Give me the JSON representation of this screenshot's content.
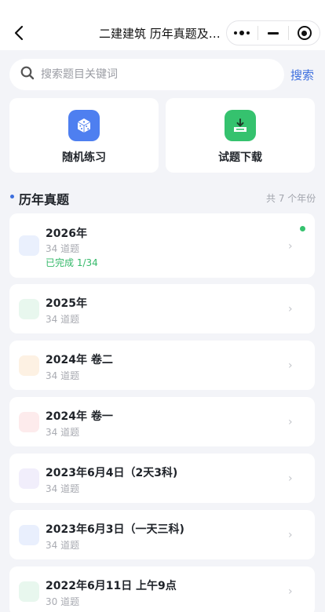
{
  "nav": {
    "title": "二建建筑 历年真题及解析"
  },
  "search": {
    "placeholder": "搜索题目关键词",
    "button_label": "搜索"
  },
  "quick": {
    "practice_label": "随机练习",
    "download_label": "试题下载"
  },
  "section": {
    "title": "历年真题",
    "count": "共 7 个年份"
  },
  "years": [
    {
      "title": "2026年",
      "sub": "34 道题",
      "progress": "已完成 1/34",
      "badge_color": "#eaf0fd"
    },
    {
      "title": "2025年",
      "sub": "34 道题",
      "badge_color": "#e8f7ee"
    },
    {
      "title": "2024年 卷二",
      "sub": "34 道题",
      "badge_color": "#fdf1e3"
    },
    {
      "title": "2024年 卷一",
      "sub": "34 道题",
      "badge_color": "#fdebec"
    },
    {
      "title": "2023年6月4日（2天3科)",
      "sub": "34 道题",
      "badge_color": "#f1eefb"
    },
    {
      "title": "2023年6月3日（一天三科)",
      "sub": "34 道题",
      "badge_color": "#e9effd"
    },
    {
      "title": "2022年6月11日 上午9点",
      "sub": "30 道题",
      "badge_color": "#e8f7ee"
    }
  ],
  "colors": {
    "accent": "#3d6fde",
    "completed": "#35b96a",
    "practice_icon_bg": "#4e7ff0",
    "download_icon_bg": "#35c26e"
  }
}
